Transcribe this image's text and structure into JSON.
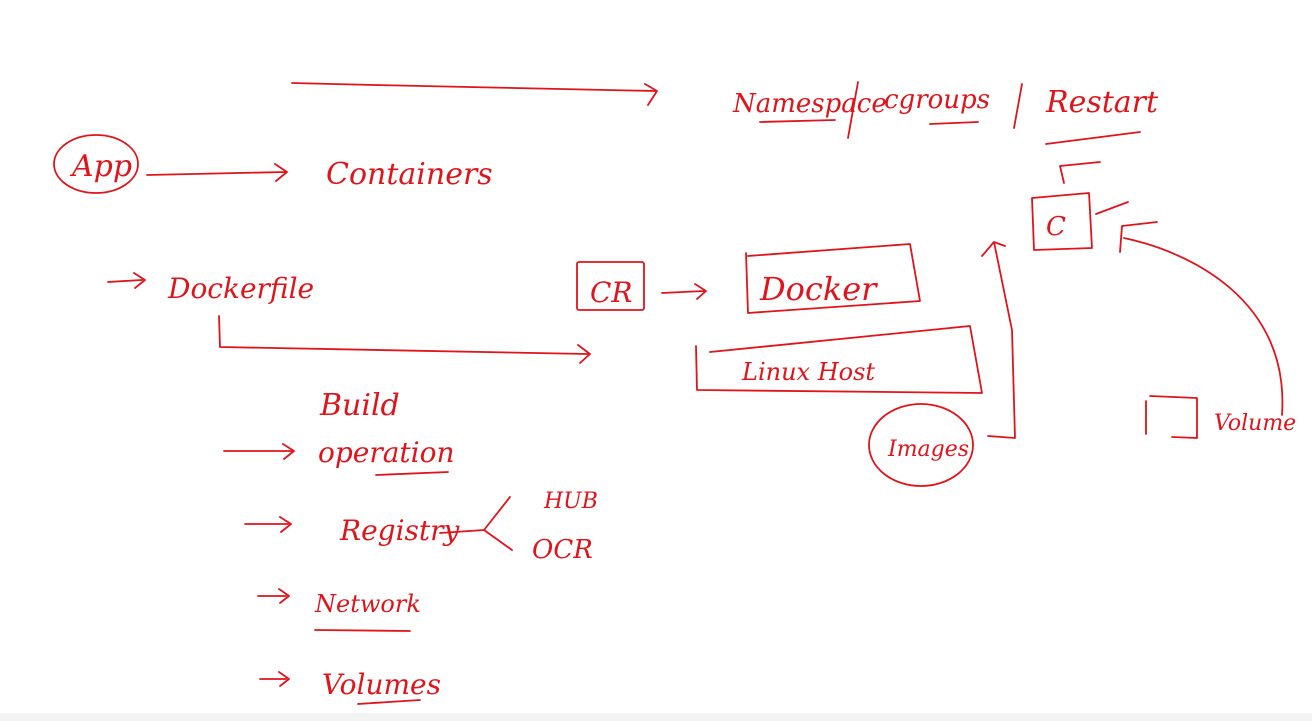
{
  "ink_color": "#e0141b",
  "labels": {
    "namespace": "Namespace",
    "cgroups": "cgroups",
    "restart": "Restart",
    "app": "App",
    "containers": "Containers",
    "dockerfile": "Dockerfile",
    "cr": "CR",
    "docker": "Docker",
    "linux_host": "Linux Host",
    "images": "Images",
    "c_box": "C",
    "volume": "Volume",
    "build": "Build",
    "operation": "operation",
    "registry": "Registry",
    "hub": "HUB",
    "ocr": "OCR",
    "network": "Network",
    "volumes": "Volumes"
  }
}
